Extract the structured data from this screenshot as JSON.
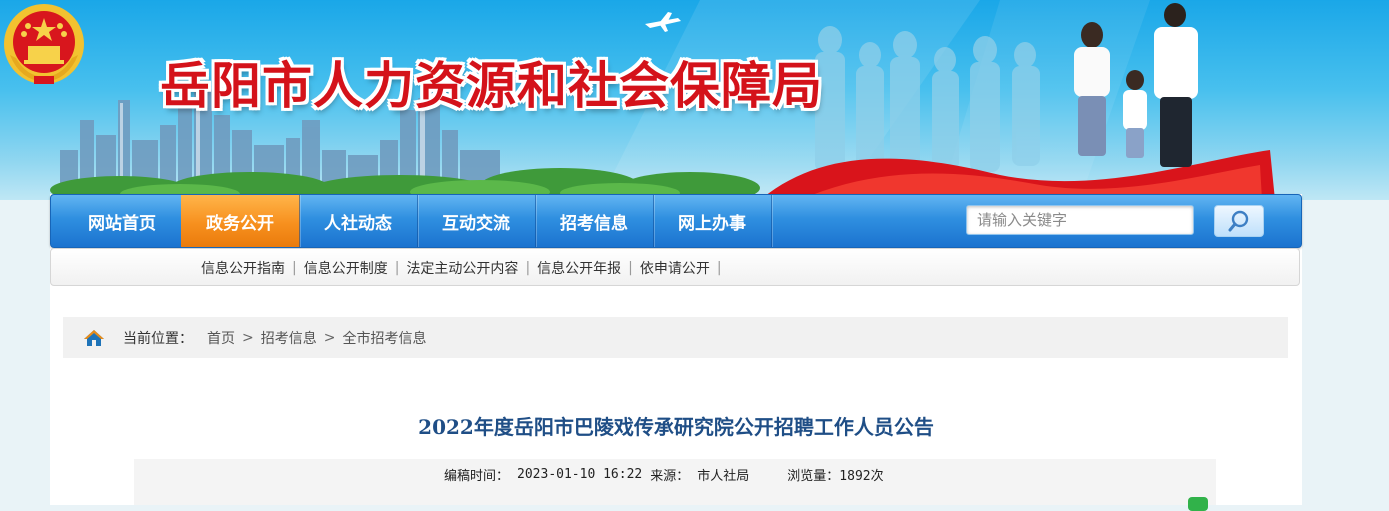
{
  "banner": {
    "title": "岳阳市人力资源和社会保障局"
  },
  "nav": {
    "items": [
      {
        "label": "网站首页",
        "active": false
      },
      {
        "label": "政务公开",
        "active": true
      },
      {
        "label": "人社动态",
        "active": false
      },
      {
        "label": "互动交流",
        "active": false
      },
      {
        "label": "招考信息",
        "active": false
      },
      {
        "label": "网上办事",
        "active": false
      }
    ],
    "active_color": "#f7901e",
    "bar_color": "#2f8fe0"
  },
  "search": {
    "placeholder": "请输入关键字",
    "button_icon": "magnifier-icon"
  },
  "subnav": {
    "items": [
      "信息公开指南",
      "信息公开制度",
      "法定主动公开内容",
      "信息公开年报",
      "依申请公开"
    ],
    "separator": "|"
  },
  "breadcrumb": {
    "icon": "home-icon",
    "label": "当前位置：",
    "items": [
      "首页",
      "招考信息",
      "全市招考信息"
    ],
    "separator": ">"
  },
  "article": {
    "title": "2022年度岳阳市巴陵戏传承研究院公开招聘工作人员公告",
    "meta": {
      "time_label": "编稿时间：",
      "time_value": "2023-01-10 16:22",
      "source_label": "来源：",
      "source_value": "市人社局",
      "views_label": "浏览量：",
      "views_value": "1892次"
    }
  }
}
